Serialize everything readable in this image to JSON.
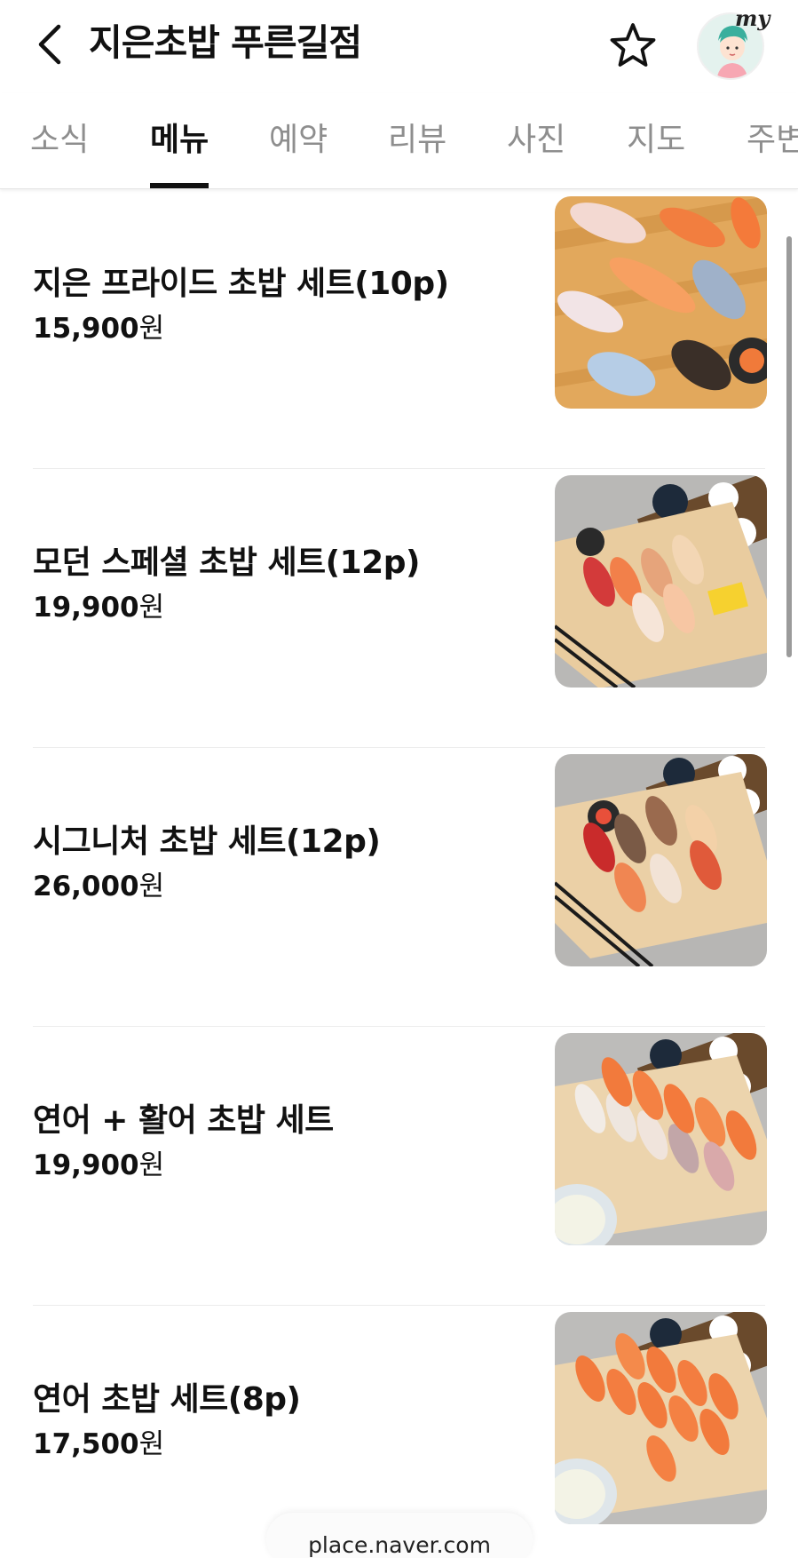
{
  "header": {
    "title": "지은초밥 푸른길점",
    "avatar_badge": "my",
    "back_icon": "chevron-left-icon",
    "favorite_icon": "star-outline-icon"
  },
  "tabs": [
    {
      "label": "소식",
      "active": false
    },
    {
      "label": "메뉴",
      "active": true
    },
    {
      "label": "예약",
      "active": false
    },
    {
      "label": "리뷰",
      "active": false
    },
    {
      "label": "사진",
      "active": false
    },
    {
      "label": "지도",
      "active": false
    },
    {
      "label": "주변",
      "active": false
    }
  ],
  "menu": {
    "items": [
      {
        "name": "지은 프라이드 초밥 세트(10p)",
        "price": "15,900",
        "currency": "원"
      },
      {
        "name": "모던 스페셜 초밥 세트(12p)",
        "price": "19,900",
        "currency": "원"
      },
      {
        "name": "시그니처 초밥 세트(12p)",
        "price": "26,000",
        "currency": "원"
      },
      {
        "name": "연어 + 활어 초밥 세트",
        "price": "19,900",
        "currency": "원"
      },
      {
        "name": "연어 초밥 세트(8p)",
        "price": "17,500",
        "currency": "원"
      }
    ]
  },
  "footer": {
    "url": "place.naver.com"
  },
  "colors": {
    "text": "#111111",
    "tab_inactive": "#8e8e8e",
    "divider": "#ececec",
    "wood": "#e8c99a",
    "salmon": "#f08a4b"
  }
}
